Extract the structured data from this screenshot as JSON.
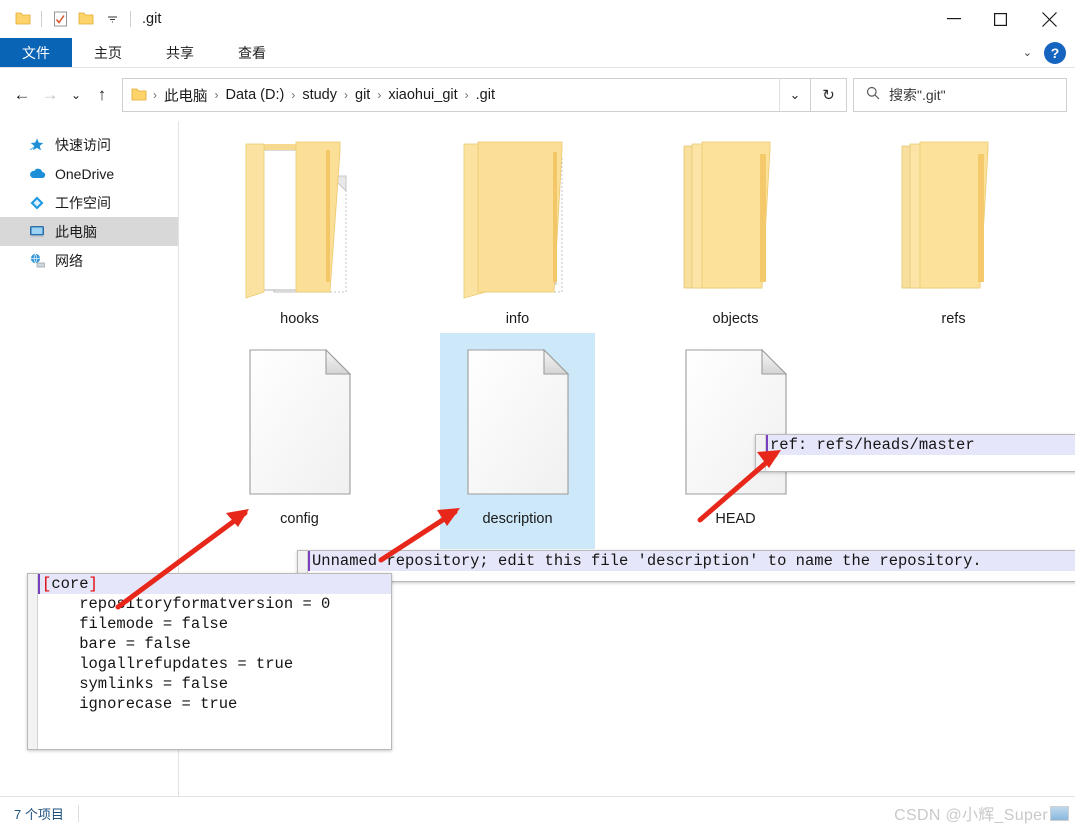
{
  "window": {
    "title": ".git",
    "quick_access_icons": [
      "folder-icon",
      "properties-icon",
      "new-folder-icon",
      "chevron-down-icon"
    ],
    "minimize_label": "—",
    "maximize_label": "□",
    "close_label": "✕"
  },
  "ribbon": {
    "tabs": [
      {
        "label": "文件",
        "key": "file",
        "active": true
      },
      {
        "label": "主页",
        "key": "home",
        "active": false
      },
      {
        "label": "共享",
        "key": "share",
        "active": false
      },
      {
        "label": "查看",
        "key": "view",
        "active": false
      }
    ],
    "collapse_label": "⌄",
    "help_label": "?"
  },
  "address": {
    "back_label": "←",
    "forward_label": "→",
    "recent_label": "⌄",
    "up_label": "↑",
    "breadcrumbs": [
      "此电脑",
      "Data (D:)",
      "study",
      "git",
      "xiaohui_git",
      ".git"
    ],
    "separator": "›",
    "dropdown_label": "⌄",
    "refresh_label": "↻"
  },
  "search": {
    "icon": "search-icon",
    "placeholder": "搜索\".git\""
  },
  "nav_pane": {
    "items": [
      {
        "label": "快速访问",
        "icon": "star-icon",
        "selected": false
      },
      {
        "label": "OneDrive",
        "icon": "cloud-icon",
        "selected": false
      },
      {
        "label": "工作空间",
        "icon": "diamond-icon",
        "selected": false
      },
      {
        "label": "此电脑",
        "icon": "computer-icon",
        "selected": true
      },
      {
        "label": "网络",
        "icon": "network-icon",
        "selected": false
      }
    ]
  },
  "files": [
    {
      "name": "hooks",
      "type": "folder-multi",
      "selected": false,
      "col": 0,
      "row": 0
    },
    {
      "name": "info",
      "type": "folder-doc",
      "selected": false,
      "col": 1,
      "row": 0
    },
    {
      "name": "objects",
      "type": "folder-stack",
      "selected": false,
      "col": 2,
      "row": 0
    },
    {
      "name": "refs",
      "type": "folder-stack",
      "selected": false,
      "col": 3,
      "row": 0
    },
    {
      "name": "config",
      "type": "file-blank",
      "selected": false,
      "col": 0,
      "row": 1
    },
    {
      "name": "description",
      "type": "file-blank",
      "selected": true,
      "col": 1,
      "row": 1
    },
    {
      "name": "HEAD",
      "type": "file-blank",
      "selected": false,
      "col": 2,
      "row": 1
    }
  ],
  "status": {
    "item_count": "7 个项目"
  },
  "watermark": {
    "text": "CSDN @小辉_Super"
  },
  "editors": {
    "head": {
      "lines": [
        {
          "text": "ref: refs/heads/master",
          "highlight": true
        }
      ]
    },
    "description": {
      "lines": [
        {
          "text": "Unnamed repository; edit this file 'description' to name the repository.",
          "highlight": true
        }
      ]
    },
    "config": {
      "lines": [
        {
          "text": "[core]",
          "highlight": true,
          "bracket": true
        },
        {
          "text": "    repositoryformatversion = 0",
          "highlight": false
        },
        {
          "text": "    filemode = false",
          "highlight": false
        },
        {
          "text": "    bare = false",
          "highlight": false
        },
        {
          "text": "    logallrefupdates = true",
          "highlight": false
        },
        {
          "text": "    symlinks = false",
          "highlight": false
        },
        {
          "text": "    ignorecase = true",
          "highlight": false
        }
      ]
    }
  },
  "colors": {
    "accent": "#0a64b5",
    "selection": "#cce8f9",
    "arrow": "#e8271b",
    "highlight_line": "#e6e6fa"
  }
}
